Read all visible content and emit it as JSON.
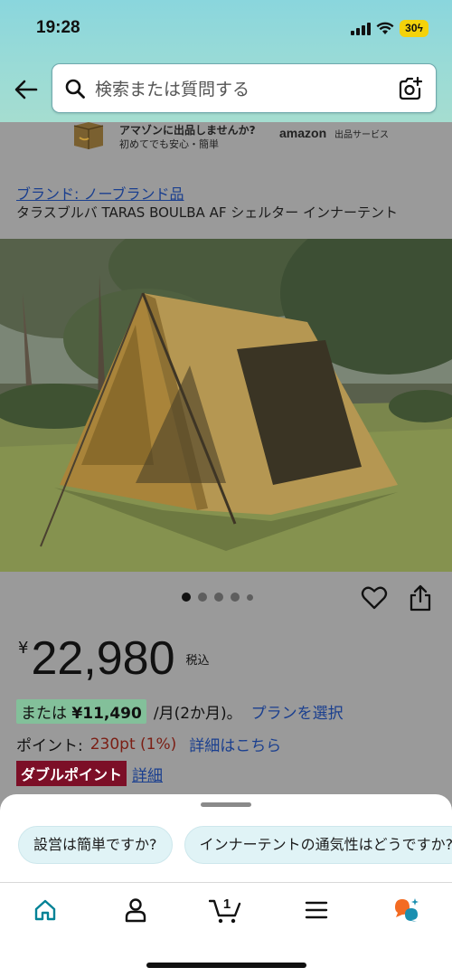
{
  "status_bar": {
    "time": "19:28",
    "battery": "30",
    "battery_color": "#f4d20a"
  },
  "search": {
    "placeholder": "検索または質問する"
  },
  "ad_banner": {
    "line1": "アマゾンに出品しませんか?",
    "line2": "初めてでも安心・簡単",
    "brand": "amazon",
    "brand_sub": "出品サービス"
  },
  "product": {
    "brand_link": "ブランド: ノーブランド品",
    "title": "タラスブルバ TARAS BOULBA AF シェルター インナーテント",
    "image_alt": "tent-photo",
    "carousel": {
      "total_dots": 5,
      "active_index": 0
    },
    "price": {
      "currency_symbol": "¥",
      "value": "22,980",
      "tax_label": "税込"
    },
    "installment": {
      "badge_prefix": "または ",
      "badge_amount": "¥11,490",
      "term": "/月(2か月)。",
      "plan_link": "プランを選択",
      "badge_color": "#83c09a"
    },
    "points": {
      "label": "ポイント:",
      "value": "230pt (1%)",
      "details_link": "詳細はこちら"
    },
    "double_point": {
      "badge": "ダブルポイント",
      "link": "詳細",
      "badge_color": "#7c0f27"
    }
  },
  "suggestion_chips": [
    "設営は簡単ですか?",
    "インナーテントの通気性はどうですか?"
  ],
  "bottom_nav": {
    "items": [
      {
        "icon": "home-icon"
      },
      {
        "icon": "profile-icon"
      },
      {
        "icon": "cart-icon",
        "badge": "1"
      },
      {
        "icon": "menu-icon"
      },
      {
        "icon": "rufus-ai-icon"
      }
    ],
    "accent_color": "#008296"
  }
}
